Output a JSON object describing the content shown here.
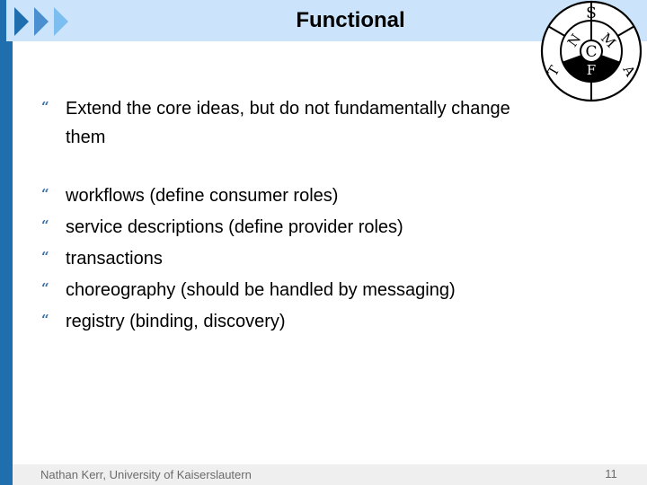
{
  "slide": {
    "title": "Functional",
    "logo": {
      "icon": "smactfnt-logo-icon",
      "letters": {
        "outer_top": "S",
        "outer_left": "T",
        "outer_right": "A",
        "inner_left": "N",
        "inner_right": "M",
        "center": "C",
        "bottom": "F"
      }
    },
    "bullet_glyph": "“",
    "intro_bullet": {
      "line1": "Extend the core ideas, but do not fundamentally change",
      "line2": "them"
    },
    "bullets": [
      "workflows (define consumer roles)",
      "service descriptions (define provider roles)",
      "transactions",
      "choreography (should be handled by messaging)",
      "registry (binding, discovery)"
    ],
    "footer": {
      "author": "Nathan Kerr, University of Kaiserslautern",
      "page_number": "11"
    }
  },
  "colors": {
    "title_band": "#cce4fb",
    "left_bar": "#1f6fae",
    "arrow_dark": "#1f6fae",
    "arrow_mid": "#4a90d0",
    "arrow_light": "#7dbef0",
    "footer_band": "#efefef",
    "bullet": "#3a6ea5"
  }
}
